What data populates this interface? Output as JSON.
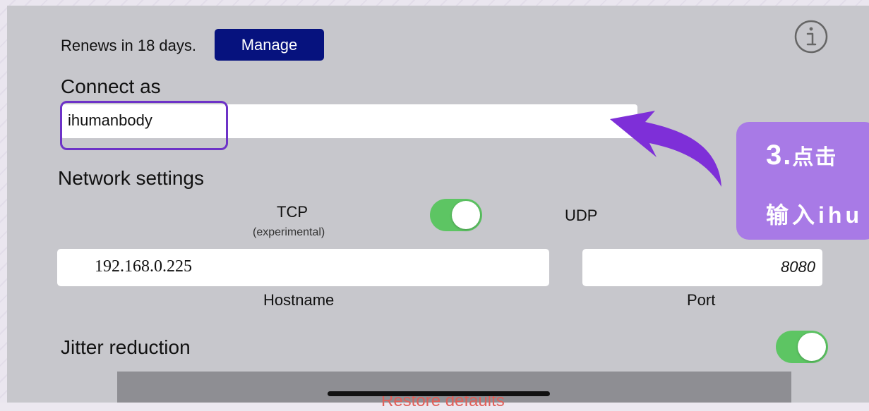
{
  "account": {
    "renews_text": "Renews in 18 days.",
    "manage_label": "Manage",
    "info_icon": "info-circle-icon"
  },
  "connect": {
    "section_label": "Connect as",
    "username_value": "ihumanbody"
  },
  "annotation": {
    "step_number": "3.",
    "line1_text": "点击",
    "line2_text": "输入ihu",
    "accent_color": "#a87ae6",
    "highlight_color": "#6d32c7"
  },
  "network": {
    "section_label": "Network settings",
    "tcp_label": "TCP",
    "tcp_sublabel": "(experimental)",
    "udp_label": "UDP",
    "protocol_toggle_on": true,
    "hostname_value": "192.168.0.225",
    "hostname_label": "Hostname",
    "port_value": "8080",
    "port_label": "Port"
  },
  "jitter": {
    "label": "Jitter reduction",
    "toggle_on": true
  },
  "footer": {
    "restore_label": "Restore defaults"
  },
  "colors": {
    "panel_bg": "#c7c7cc",
    "manage_bg": "#06127e",
    "toggle_on": "#5dc563"
  }
}
